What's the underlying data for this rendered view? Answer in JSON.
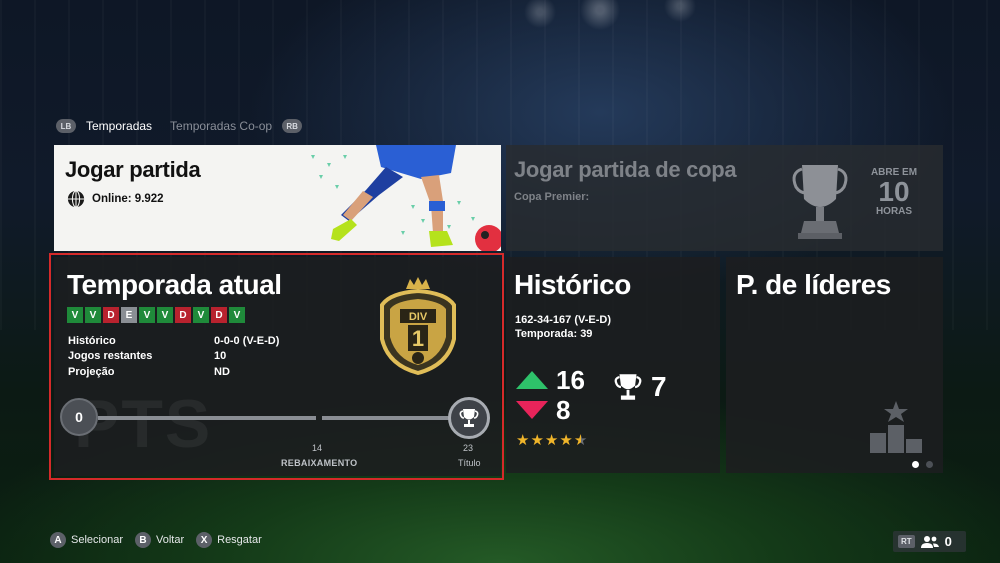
{
  "tabs": {
    "left_shoulder": "LB",
    "right_shoulder": "RB",
    "items": [
      {
        "label": "Temporadas",
        "active": true
      },
      {
        "label": "Temporadas Co-op",
        "active": false
      }
    ]
  },
  "play_card": {
    "title": "Jogar partida",
    "online_label": "Online: 9.922"
  },
  "cup_card": {
    "title": "Jogar partida de copa",
    "subtitle": "Copa Premier:",
    "opens_prefix": "ABRE EM",
    "opens_value": "10",
    "opens_unit": "HORAS"
  },
  "season_card": {
    "title": "Temporada atual",
    "results": [
      "V",
      "V",
      "D",
      "E",
      "V",
      "V",
      "D",
      "V",
      "D",
      "V"
    ],
    "stats": [
      {
        "label": "Histórico",
        "value": "0-0-0 (V-E-D)"
      },
      {
        "label": "Jogos restantes",
        "value": "10"
      },
      {
        "label": "Projeção",
        "value": "ND"
      }
    ],
    "division_label": "DIV",
    "division_number": "1",
    "pts_watermark": "PTS",
    "progress_start": "0",
    "relegation_mark": "14",
    "relegation_label": "REBAIXAMENTO",
    "title_mark": "23",
    "title_label": "Título"
  },
  "history_card": {
    "title": "Histórico",
    "record": "162-34-167 (V-E-D)",
    "seasons": "Temporada: 39",
    "promotions": "16",
    "relegations": "8",
    "titles": "7",
    "rating_stars": 4.5
  },
  "leaders_card": {
    "title": "P. de líderes",
    "page": 1,
    "page_count": 2
  },
  "hints": [
    {
      "button": "A",
      "label": "Selecionar"
    },
    {
      "button": "B",
      "label": "Voltar"
    },
    {
      "button": "X",
      "label": "Resgatar"
    }
  ],
  "friends": {
    "trigger": "RT",
    "count": "0"
  },
  "colors": {
    "win": "#1f8a3a",
    "loss": "#b8222e",
    "draw": "#8a8e94",
    "up": "#2ec26a",
    "down": "#e8245a",
    "star": "#f0b52a",
    "focus_outline": "#d42a2a"
  }
}
